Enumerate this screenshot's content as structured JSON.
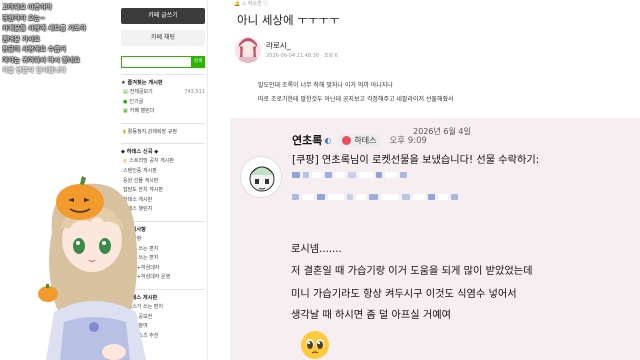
{
  "overlay_chat": {
    "lines": [
      "고마워요 따뜻하다",
      "영원하자 오는~",
      "카페분들 사랑해 세트를 기도하",
      "멤버분 가서요",
      "몽글미 사랑해요 수줍거",
      "여자는 귀여워서 다시 했네요",
      "처음 방문자 인사합니다"
    ]
  },
  "sidebar": {
    "write_button": "카페 글쓰기",
    "chat_button": "카페 채팅",
    "search_button": "검색",
    "favorites_header": "즐겨찾는 게시판",
    "stats": [
      {
        "label": "전체글보기",
        "count": "743,511"
      },
      {
        "label": "인기글",
        "count": ""
      },
      {
        "label": "카페 캘린더",
        "count": ""
      }
    ],
    "notice_line": "활동정지,강제퇴장 규정",
    "new_header": "하데스 신곡 ◆",
    "new_items": [
      "스트리밍 공지 게시판",
      "스탠인증 게시판",
      "응원 선물 게시판",
      "잡담도 한치 게시판",
      "하데스 게시판",
      "하데스 챌린지"
    ],
    "notice_header": "공지사항",
    "notice_items": [
      "공지사항",
      "봉준이 쓰는 편지",
      "무우가 쓰는 편지",
      "오봉판+하심데자",
      "오봉판+하심데자 운영"
    ],
    "board_header": "하데스 게시판",
    "board_items": [
      "하데스가 쓰는 편지",
      "하데스 공모전",
      "시청자 참여",
      "하데스 쇼츠 추천"
    ]
  },
  "post": {
    "breadcrumb": "🔔 ⚠ 하소연 ⓘ",
    "title": "아니 세상에 ㅜㅜㅜㅜ",
    "author": "라로시_",
    "date": "2026-06-04 21:48:30 · 조회 6",
    "body_lines": [
      "말도안대 조록이 너무 착해 맞지나 이거 억까 아니지나",
      "따로 조로기한테 말한것두 아닌데 공지보고 걱정해주고 네팔라이저 선물해줬서"
    ]
  },
  "capture": {
    "date": "2026년 6월 4일",
    "nickname": "연초록",
    "tag": "하데스",
    "time": "오후 9:09",
    "gift_line": "[쿠팡] 연초록님이 로켓선물을 보냈습니다! 선물 수락하기:",
    "greeting": "로시넴.......",
    "lines": [
      "저 결혼일 때 가습기랑 이거 도움을 되게 많이 받았었는데",
      "미니 가습기라도 항상 켜두시구 이것도 식염수 넣어서",
      "생각날 때 하시면 좀 덜 아프실 거예여"
    ]
  },
  "colors": {
    "accent_green": "#2db400",
    "capture_bg": "#f6eef1",
    "write_btn": "#3b3b3b"
  }
}
